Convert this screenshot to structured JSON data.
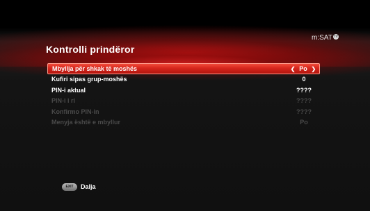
{
  "header": {
    "title": "Kontrolli prindëror",
    "brand": "m:SAT",
    "brand_badge": "TV"
  },
  "menu": {
    "items": [
      {
        "label": "Mbyllja për shkak të moshës",
        "value": "Po",
        "left_arrow": "❮",
        "right_arrow": "❯",
        "selected": true
      },
      {
        "label": "Kufiri sipas grup-moshës",
        "value": "0"
      },
      {
        "label": "PIN-i aktual",
        "value": "????"
      },
      {
        "label": "PIN-i i ri",
        "value": "????"
      },
      {
        "label": "Konfirmo PIN-in",
        "value": "????"
      },
      {
        "label": "Menyja është e mbyllur",
        "value": "Po"
      }
    ]
  },
  "footer": {
    "exit_button": "EXIT",
    "label": "Dalja"
  },
  "colors": {
    "accent": "#d6261c",
    "dim_text": "#4a4a4a",
    "background": "#111111"
  }
}
